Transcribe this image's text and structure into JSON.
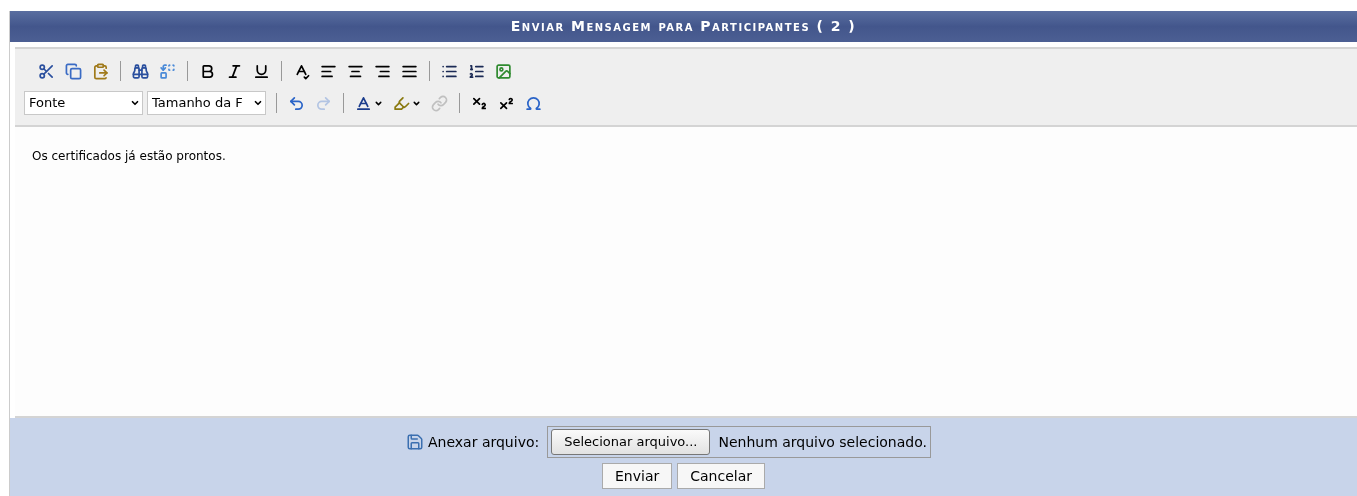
{
  "title": "Enviar Mensagem para Participantes ( 2 )",
  "toolbar_rows": [
    [
      {
        "kind": "cut",
        "disabled": false
      },
      {
        "kind": "copy",
        "disabled": false
      },
      {
        "kind": "paste",
        "disabled": false
      },
      {
        "kind": "separator"
      },
      {
        "kind": "find",
        "disabled": false
      },
      {
        "kind": "replace",
        "disabled": false
      },
      {
        "kind": "separator"
      },
      {
        "kind": "bold",
        "disabled": false
      },
      {
        "kind": "italic",
        "disabled": false
      },
      {
        "kind": "underline",
        "disabled": false
      },
      {
        "kind": "separator"
      },
      {
        "kind": "spellcheck",
        "disabled": false
      },
      {
        "kind": "align-left",
        "disabled": false
      },
      {
        "kind": "align-center",
        "disabled": false
      },
      {
        "kind": "align-right",
        "disabled": false
      },
      {
        "kind": "align-justify",
        "disabled": false
      },
      {
        "kind": "separator"
      },
      {
        "kind": "bullet-list",
        "disabled": false
      },
      {
        "kind": "numbered-list",
        "disabled": false
      },
      {
        "kind": "image",
        "disabled": false
      }
    ],
    [
      {
        "kind": "select",
        "value": "Fonte"
      },
      {
        "kind": "select",
        "value": "Tamanho da F"
      },
      {
        "kind": "separator"
      },
      {
        "kind": "undo",
        "disabled": false
      },
      {
        "kind": "redo",
        "disabled": true
      },
      {
        "kind": "separator"
      },
      {
        "kind": "text-color",
        "disabled": false
      },
      {
        "kind": "highlight",
        "disabled": false
      },
      {
        "kind": "link",
        "disabled": true
      },
      {
        "kind": "separator"
      },
      {
        "kind": "subscript",
        "disabled": false
      },
      {
        "kind": "superscript",
        "disabled": false
      },
      {
        "kind": "omega",
        "disabled": false
      }
    ]
  ],
  "editor": {
    "text": "Os certificados já estão prontos."
  },
  "attachment": {
    "label": "Anexar arquivo:",
    "button": "Selecionar arquivo...",
    "status": "Nenhum arquivo selecionado."
  },
  "buttons": [
    "Enviar",
    "Cancelar"
  ]
}
